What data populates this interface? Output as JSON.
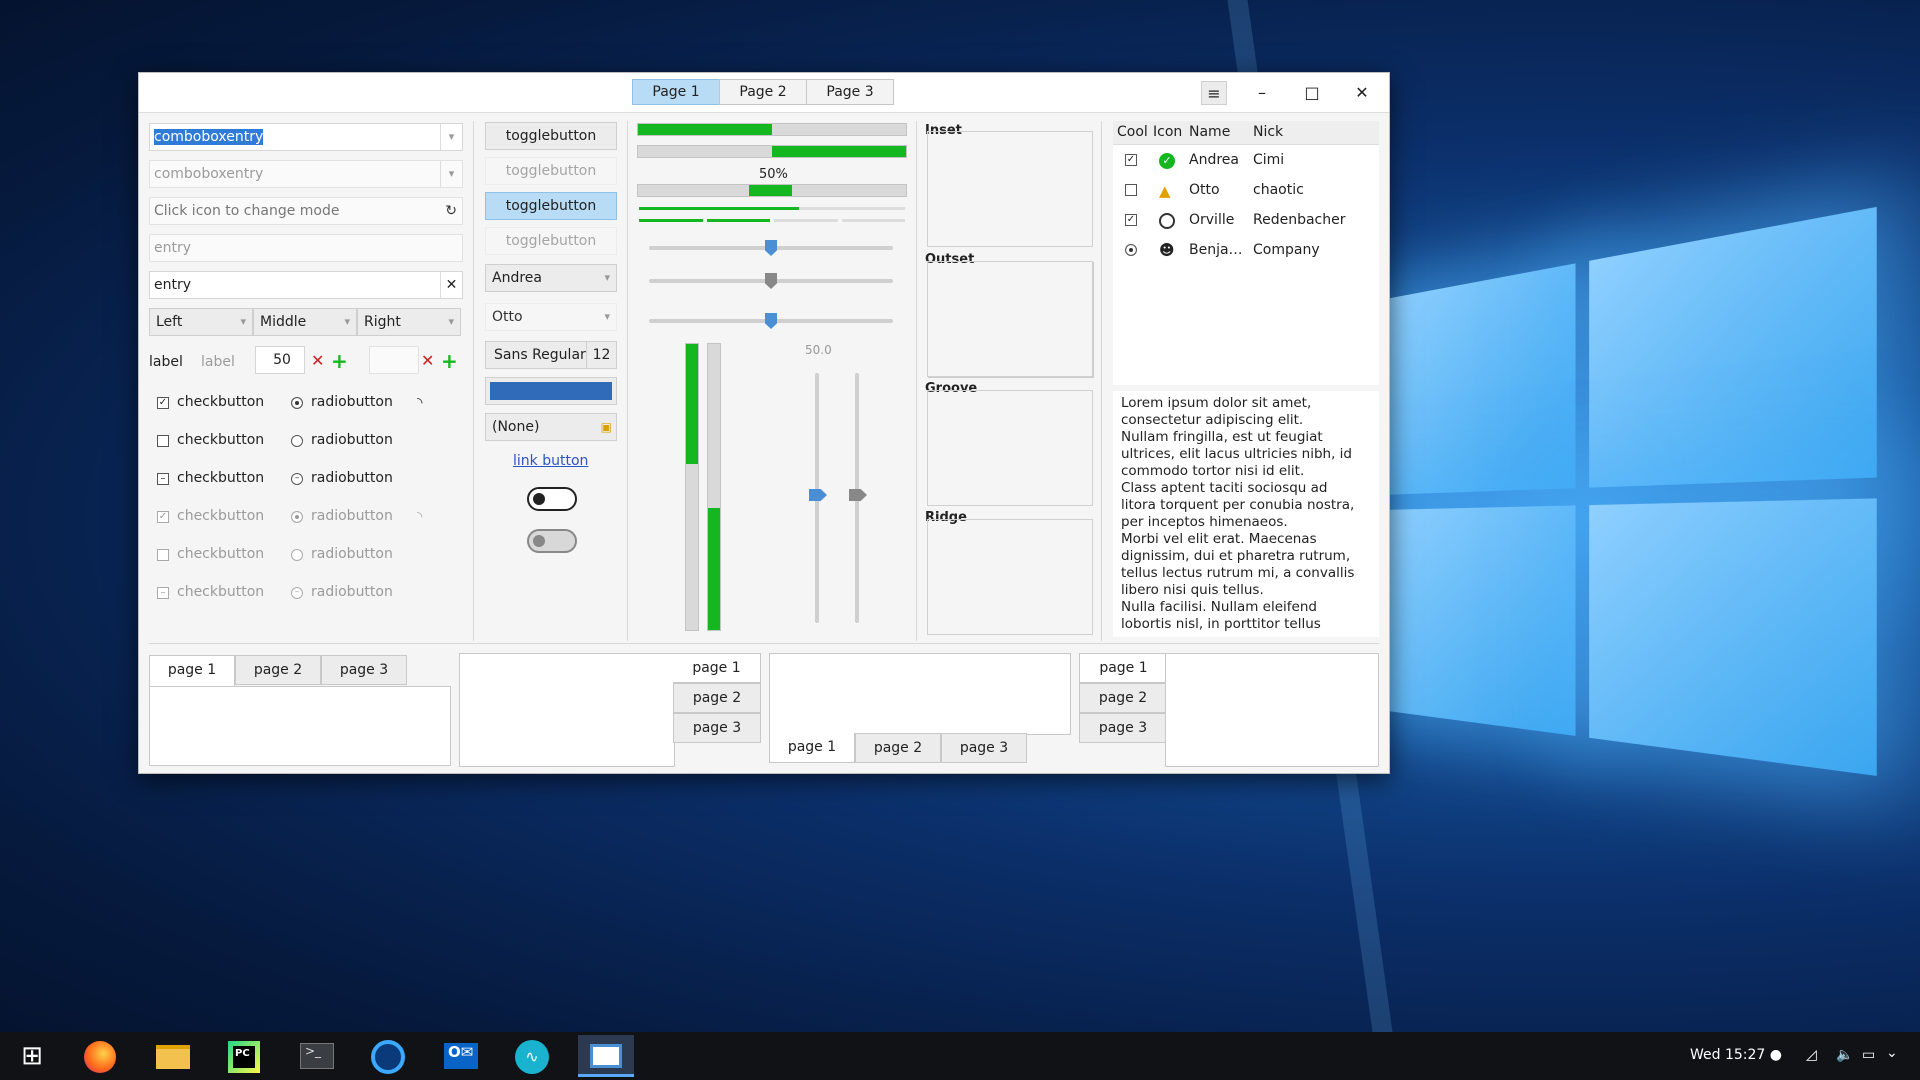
{
  "window": {
    "stack_tabs": [
      "Page 1",
      "Page 2",
      "Page 3"
    ]
  },
  "left": {
    "combo_entry": "comboboxentry",
    "combo_entry_disabled": "comboboxentry",
    "mode_entry_placeholder": "Click icon to change mode",
    "entry_disabled": "entry",
    "entry": "entry",
    "align_combos": [
      "Left",
      "Middle",
      "Right"
    ],
    "label1": "label",
    "label2": "label",
    "spin_value": "50",
    "checks": [
      "checkbutton",
      "checkbutton",
      "checkbutton",
      "checkbutton",
      "checkbutton",
      "checkbutton"
    ],
    "radios": [
      "radiobutton",
      "radiobutton",
      "radiobutton",
      "radiobutton",
      "radiobutton",
      "radiobutton"
    ]
  },
  "mid": {
    "toggles": [
      "togglebutton",
      "togglebutton",
      "togglebutton",
      "togglebutton"
    ],
    "combo1": "Andrea",
    "combo2": "Otto",
    "font_name": "Sans Regular",
    "font_size": "12",
    "file_chooser": "(None)",
    "link": "link button",
    "switch1_on": true,
    "switch2_on": false
  },
  "progress": {
    "bar1": 0.5,
    "bar2": 0.5,
    "bar3_label": "50%",
    "bar3": 0.5,
    "scale_value": "50.0",
    "level1": 0.6,
    "level2": 0.5
  },
  "frames": [
    "Inset",
    "Outset",
    "Groove",
    "Ridge"
  ],
  "tree": {
    "headers": [
      "Cool",
      "Icon",
      "Name",
      "Nick"
    ],
    "rows": [
      {
        "name": "Andrea",
        "nick": "Cimi",
        "cool": "check",
        "icon": "ok-icon"
      },
      {
        "name": "Otto",
        "nick": "chaotic",
        "cool": "empty",
        "icon": "warning-icon"
      },
      {
        "name": "Orville",
        "nick": "Redenbacher",
        "cool": "check",
        "icon": "circle-icon"
      },
      {
        "name": "Benja…",
        "nick": "Company",
        "cool": "radio",
        "icon": "person-icon"
      }
    ]
  },
  "textview": [
    "Lorem ipsum dolor sit amet,",
    "consectetur adipiscing elit.",
    "Nullam fringilla, est ut feugiat",
    "ultrices, elit lacus ultricies nibh, id",
    "commodo tortor nisi id elit.",
    "Class aptent taciti sociosqu ad",
    "litora torquent per conubia nostra,",
    "per inceptos himenaeos.",
    "Morbi vel elit erat. Maecenas",
    "dignissim, dui et pharetra rutrum,",
    "tellus lectus rutrum mi, a convallis",
    "libero nisi quis tellus.",
    "Nulla facilisi. Nullam eleifend",
    "lobortis nisl, in porttitor tellus"
  ],
  "notebook_tabs": [
    "page 1",
    "page 2",
    "page 3"
  ],
  "taskbar": {
    "clock": "Wed 15:27 ●"
  },
  "colors": {
    "accent": "#b8dcf6",
    "progress": "#14b71f",
    "desktop": "#0b2f6a"
  }
}
